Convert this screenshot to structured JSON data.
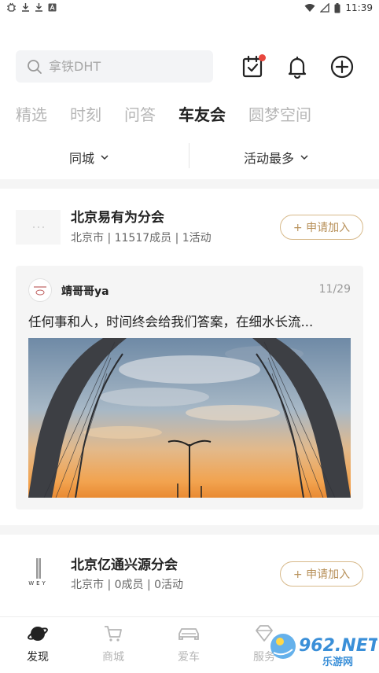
{
  "status_bar": {
    "time": "11:39",
    "left_icons": [
      "bug-icon",
      "download-icon",
      "download-icon",
      "text-icon"
    ],
    "right_icons": [
      "wifi-icon",
      "signal-icon",
      "battery-icon"
    ]
  },
  "search": {
    "placeholder": "拿铁DHT"
  },
  "header_icons": [
    "calendar-check-icon",
    "bell-icon",
    "plus-circle-icon"
  ],
  "tabs": [
    {
      "label": "精选",
      "active": false
    },
    {
      "label": "时刻",
      "active": false
    },
    {
      "label": "问答",
      "active": false
    },
    {
      "label": "车友会",
      "active": true
    },
    {
      "label": "圆梦空间",
      "active": false
    }
  ],
  "filters": {
    "city": "同城",
    "sort": "活动最多"
  },
  "clubs": [
    {
      "name": "北京易有为分会",
      "meta": "北京市 | 11517成员 | 1活动",
      "join_label": "+ 申请加入",
      "post": {
        "author": "靖哥哥ya",
        "date": "11/29",
        "text": "任何事和人，时间终会给我们答案，在细水长流..."
      }
    },
    {
      "name": "北京亿通兴源分会",
      "meta": "北京市 | 0成员 | 0活动",
      "join_label": "+ 申请加入",
      "logo_text": "WEY"
    }
  ],
  "bottom_nav": [
    {
      "label": "发现",
      "icon": "planet-icon",
      "active": true
    },
    {
      "label": "商城",
      "icon": "cart-icon",
      "active": false
    },
    {
      "label": "爱车",
      "icon": "car-icon",
      "active": false
    },
    {
      "label": "服务",
      "icon": "diamond-icon",
      "active": false
    }
  ],
  "watermark": {
    "brand": "962.NET",
    "sub": "乐游网"
  },
  "colors": {
    "accent_gold": "#b8915a",
    "notification_red": "#e8473e",
    "inactive_gray": "#b6b6b6"
  }
}
